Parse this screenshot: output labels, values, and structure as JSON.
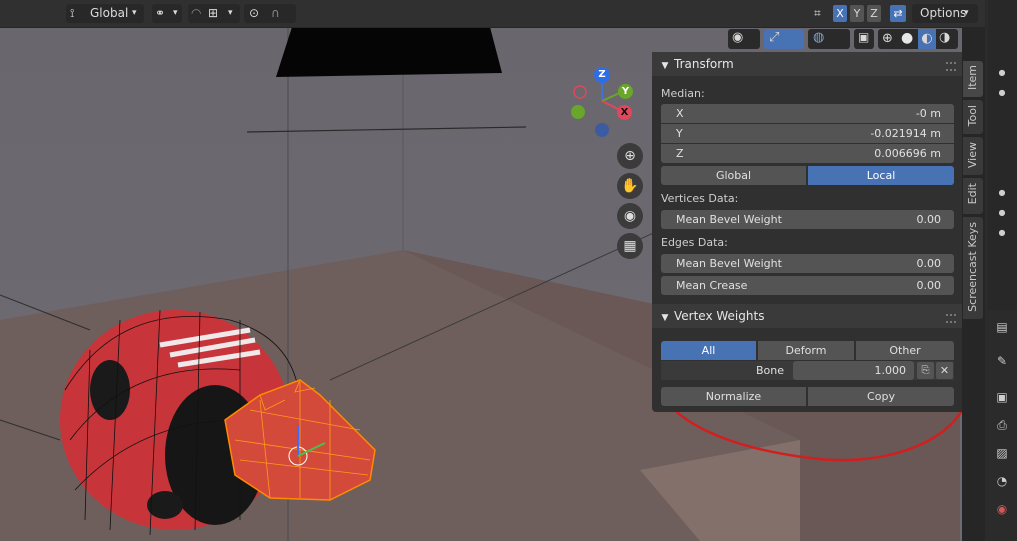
{
  "header": {
    "orientation": "Global",
    "options_label": "Options",
    "axis_x": "X",
    "axis_y": "Y",
    "axis_z": "Z"
  },
  "gizmo": {
    "x": "X",
    "y": "Y",
    "z": "Z"
  },
  "tabs": [
    {
      "label": "Item",
      "active": true
    },
    {
      "label": "Tool",
      "active": false
    },
    {
      "label": "View",
      "active": false
    },
    {
      "label": "Edit",
      "active": false
    },
    {
      "label": "Screencast Keys",
      "active": false
    }
  ],
  "transform": {
    "title": "Transform",
    "median_label": "Median:",
    "x_label": "X",
    "x_value": "-0 m",
    "y_label": "Y",
    "y_value": "-0.021914 m",
    "z_label": "Z",
    "z_value": "0.006696 m",
    "global_label": "Global",
    "local_label": "Local",
    "vertices_label": "Vertices Data:",
    "vert_bevel_label": "Mean Bevel Weight",
    "vert_bevel_value": "0.00",
    "edges_label": "Edges Data:",
    "edge_bevel_label": "Mean Bevel Weight",
    "edge_bevel_value": "0.00",
    "crease_label": "Mean Crease",
    "crease_value": "0.00"
  },
  "vertex_weights": {
    "title": "Vertex Weights",
    "all_label": "All",
    "deform_label": "Deform",
    "other_label": "Other",
    "bone_label": "Bone",
    "bone_value": "1.000",
    "normalize_label": "Normalize",
    "copy_label": "Copy"
  },
  "colors": {
    "accent": "#4772b3",
    "selection": "#ff8a00",
    "annotation": "#d11f1f"
  }
}
